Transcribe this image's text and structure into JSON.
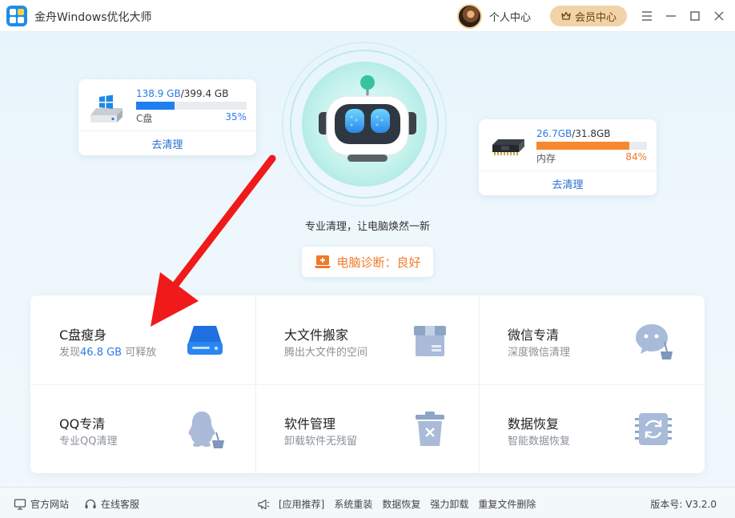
{
  "titlebar": {
    "app_title": "金舟Windows优化大师",
    "personal_center": "个人中心",
    "vip_center": "会员中心"
  },
  "disk_c": {
    "used": "138.9 GB",
    "total_sep": "/399.4 GB",
    "label": "C盘",
    "percent": "35%",
    "percent_value": 0.35,
    "clean": "去清理",
    "bar_color": "#1f7ef0"
  },
  "memory": {
    "used": "26.7GB",
    "total_sep": "/31.8GB",
    "label": "内存",
    "percent": "84%",
    "percent_value": 0.84,
    "clean": "去清理",
    "bar_color": "#f6892e"
  },
  "hero": {
    "slogan": "专业清理，让电脑焕然一新",
    "diagnosis": "电脑诊断：良好"
  },
  "tools": {
    "c_slim": {
      "title": "C盘瘦身",
      "sub_pre": "发现",
      "sub_value": "46.8 GB",
      "sub_post": " 可释放"
    },
    "big_file": {
      "title": "大文件搬家",
      "sub": "腾出大文件的空间"
    },
    "wechat": {
      "title": "微信专清",
      "sub": "深度微信清理"
    },
    "qq": {
      "title": "QQ专清",
      "sub": "专业QQ清理"
    },
    "software": {
      "title": "软件管理",
      "sub": "卸载软件无残留"
    },
    "recovery": {
      "title": "数据恢复",
      "sub": "智能数据恢复"
    }
  },
  "footer": {
    "website": "官方网站",
    "service": "在线客服",
    "recommend": "[应用推荐]",
    "links": [
      "系统重装",
      "数据恢复",
      "强力卸载",
      "重复文件删除"
    ],
    "version": "版本号: V3.2.0"
  },
  "colors": {
    "accent_blue": "#2a7be8",
    "accent_orange": "#f07a2a",
    "arrow_red": "#f01a1a"
  }
}
